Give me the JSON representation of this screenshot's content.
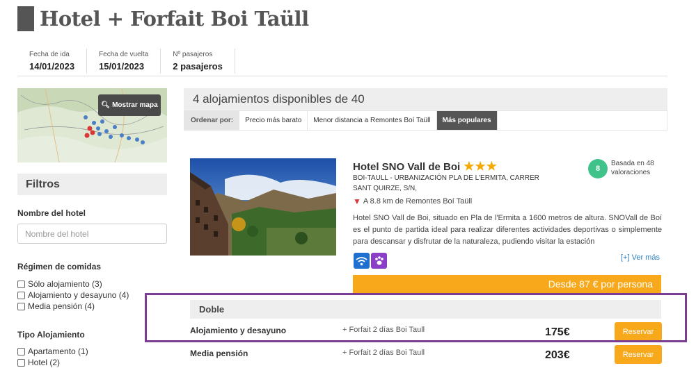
{
  "page": {
    "title": "Hotel + Forfait Boi Taüll"
  },
  "trip": [
    {
      "label": "Fecha de ida",
      "value": "14/01/2023"
    },
    {
      "label": "Fecha de vuelta",
      "value": "15/01/2023"
    },
    {
      "label": "Nº pasajeros",
      "value": "2 pasajeros"
    }
  ],
  "map": {
    "button_label": "Mostrar mapa",
    "button_icon": "zoom-icon"
  },
  "filters": {
    "title": "Filtros",
    "hotel_name_label": "Nombre del hotel",
    "hotel_name_placeholder": "Nombre del hotel",
    "meals_label": "Régimen de comidas",
    "meals": [
      "Sólo alojamiento (3)",
      "Alojamiento y desayuno (4)",
      "Media pensión (4)"
    ],
    "type_label": "Tipo Alojamiento",
    "types": [
      "Apartamento (1)",
      "Hotel (2)"
    ]
  },
  "results": {
    "summary": "4 alojamientos disponibles de 40",
    "sort_label": "Ordenar por:",
    "sort_options": [
      "Precio más barato",
      "Menor distancia a Remontes Boí Taüll",
      "Más populares"
    ],
    "sort_active": "Más populares"
  },
  "hotel": {
    "name": "Hotel SNO Vall de Boi",
    "stars": 3,
    "stars_text": "★★★",
    "address": "BOI-TAULL - URBANIZACIÓN PLA DE L'ERMITA, CARRER SANT QUIRZE, S/N,",
    "distance": "A 8.8 km de Remontes Boí Taüll",
    "rating": "8",
    "rating_text": "Basada en 48 valoraciones",
    "description": "Hotel SNO Vall de Boi, situado en Pla de l'Ermita a 1600 metros de altura. SNOVall de Boí es el punto de partida ideal para realizar diferentes actividades deportivas o simplemente para descansar y disfrutar de la naturaleza, pudiendo visitar la estación",
    "amenities": [
      "wifi-icon",
      "pets-icon"
    ],
    "see_more": "[+] Ver más",
    "price_from": "Desde 87 € por persona",
    "room": {
      "type": "Doble",
      "options": [
        {
          "regime": "Alojamiento y desayuno",
          "extra": "+ Forfait 2 días Boi Taull",
          "price": "175€",
          "button": "Reservar"
        },
        {
          "regime": "Media pensión",
          "extra": "+ Forfait 2 días Boi Taull",
          "price": "203€",
          "button": "Reservar"
        }
      ]
    }
  },
  "colors": {
    "accent": "#f7a81b",
    "rating": "#3fc38b",
    "highlight": "#7b3d91",
    "star": "#f7a800"
  }
}
